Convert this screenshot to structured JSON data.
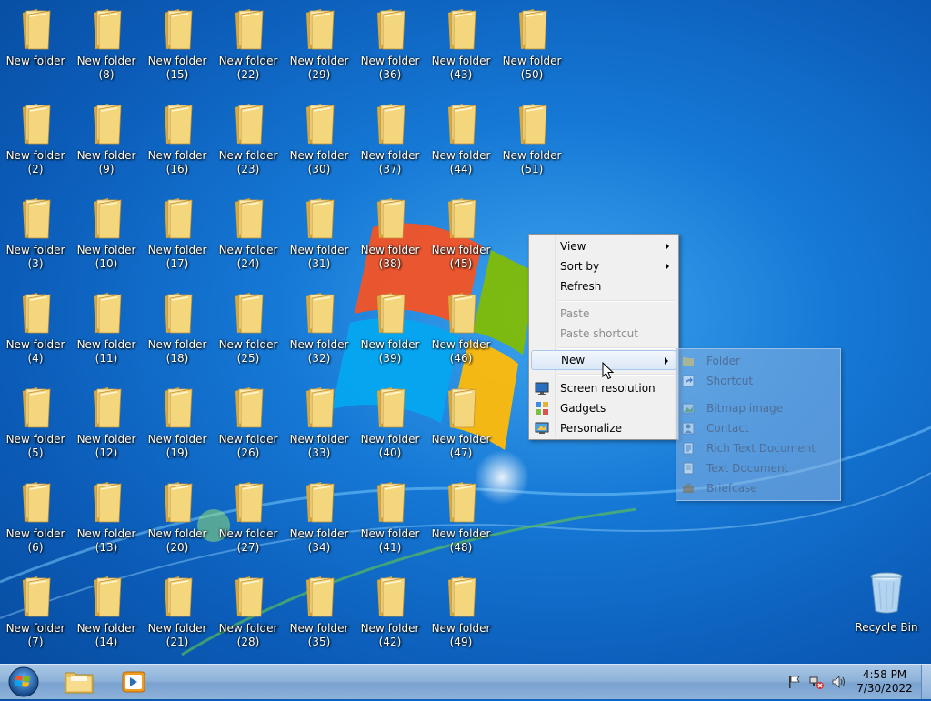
{
  "desktop": {
    "icons": [
      {
        "label": "New folder"
      },
      {
        "label": "New folder\n(2)"
      },
      {
        "label": "New folder\n(3)"
      },
      {
        "label": "New folder\n(4)"
      },
      {
        "label": "New folder\n(5)"
      },
      {
        "label": "New folder\n(6)"
      },
      {
        "label": "New folder\n(7)"
      },
      {
        "label": "New folder\n(8)"
      },
      {
        "label": "New folder\n(9)"
      },
      {
        "label": "New folder\n(10)"
      },
      {
        "label": "New folder\n(11)"
      },
      {
        "label": "New folder\n(12)"
      },
      {
        "label": "New folder\n(13)"
      },
      {
        "label": "New folder\n(14)"
      },
      {
        "label": "New folder\n(15)"
      },
      {
        "label": "New folder\n(16)"
      },
      {
        "label": "New folder\n(17)"
      },
      {
        "label": "New folder\n(18)"
      },
      {
        "label": "New folder\n(19)"
      },
      {
        "label": "New folder\n(20)"
      },
      {
        "label": "New folder\n(21)"
      },
      {
        "label": "New folder\n(22)"
      },
      {
        "label": "New folder\n(23)"
      },
      {
        "label": "New folder\n(24)"
      },
      {
        "label": "New folder\n(25)"
      },
      {
        "label": "New folder\n(26)"
      },
      {
        "label": "New folder\n(27)"
      },
      {
        "label": "New folder\n(28)"
      },
      {
        "label": "New folder\n(29)"
      },
      {
        "label": "New folder\n(30)"
      },
      {
        "label": "New folder\n(31)"
      },
      {
        "label": "New folder\n(32)"
      },
      {
        "label": "New folder\n(33)"
      },
      {
        "label": "New folder\n(34)"
      },
      {
        "label": "New folder\n(35)"
      },
      {
        "label": "New folder\n(36)"
      },
      {
        "label": "New folder\n(37)"
      },
      {
        "label": "New folder\n(38)"
      },
      {
        "label": "New folder\n(39)"
      },
      {
        "label": "New folder\n(40)"
      },
      {
        "label": "New folder\n(41)"
      },
      {
        "label": "New folder\n(42)"
      },
      {
        "label": "New folder\n(43)"
      },
      {
        "label": "New folder\n(44)"
      },
      {
        "label": "New folder\n(45)"
      },
      {
        "label": "New folder\n(46)"
      },
      {
        "label": "New folder\n(47)"
      },
      {
        "label": "New folder\n(48)"
      },
      {
        "label": "New folder\n(49)"
      },
      {
        "label": "New folder\n(50)"
      },
      {
        "label": "New folder\n(51)"
      }
    ],
    "recycle_bin_label": "Recycle Bin"
  },
  "context_menu": {
    "view": "View",
    "sort_by": "Sort by",
    "refresh": "Refresh",
    "paste": "Paste",
    "paste_shortcut": "Paste shortcut",
    "new": "New",
    "screen_resolution": "Screen resolution",
    "gadgets": "Gadgets",
    "personalize": "Personalize"
  },
  "new_submenu": {
    "folder": "Folder",
    "shortcut": "Shortcut",
    "bitmap_image": "Bitmap image",
    "contact": "Contact",
    "rich_text_document": "Rich Text Document",
    "text_document": "Text Document",
    "briefcase": "Briefcase"
  },
  "taskbar": {
    "clock_time": "4:58 PM",
    "clock_date": "7/30/2022"
  },
  "colors": {
    "desktop_blue": "#1679d6",
    "menu_bg": "#f0f0f0",
    "folder_yellow": "#f4d77c"
  }
}
